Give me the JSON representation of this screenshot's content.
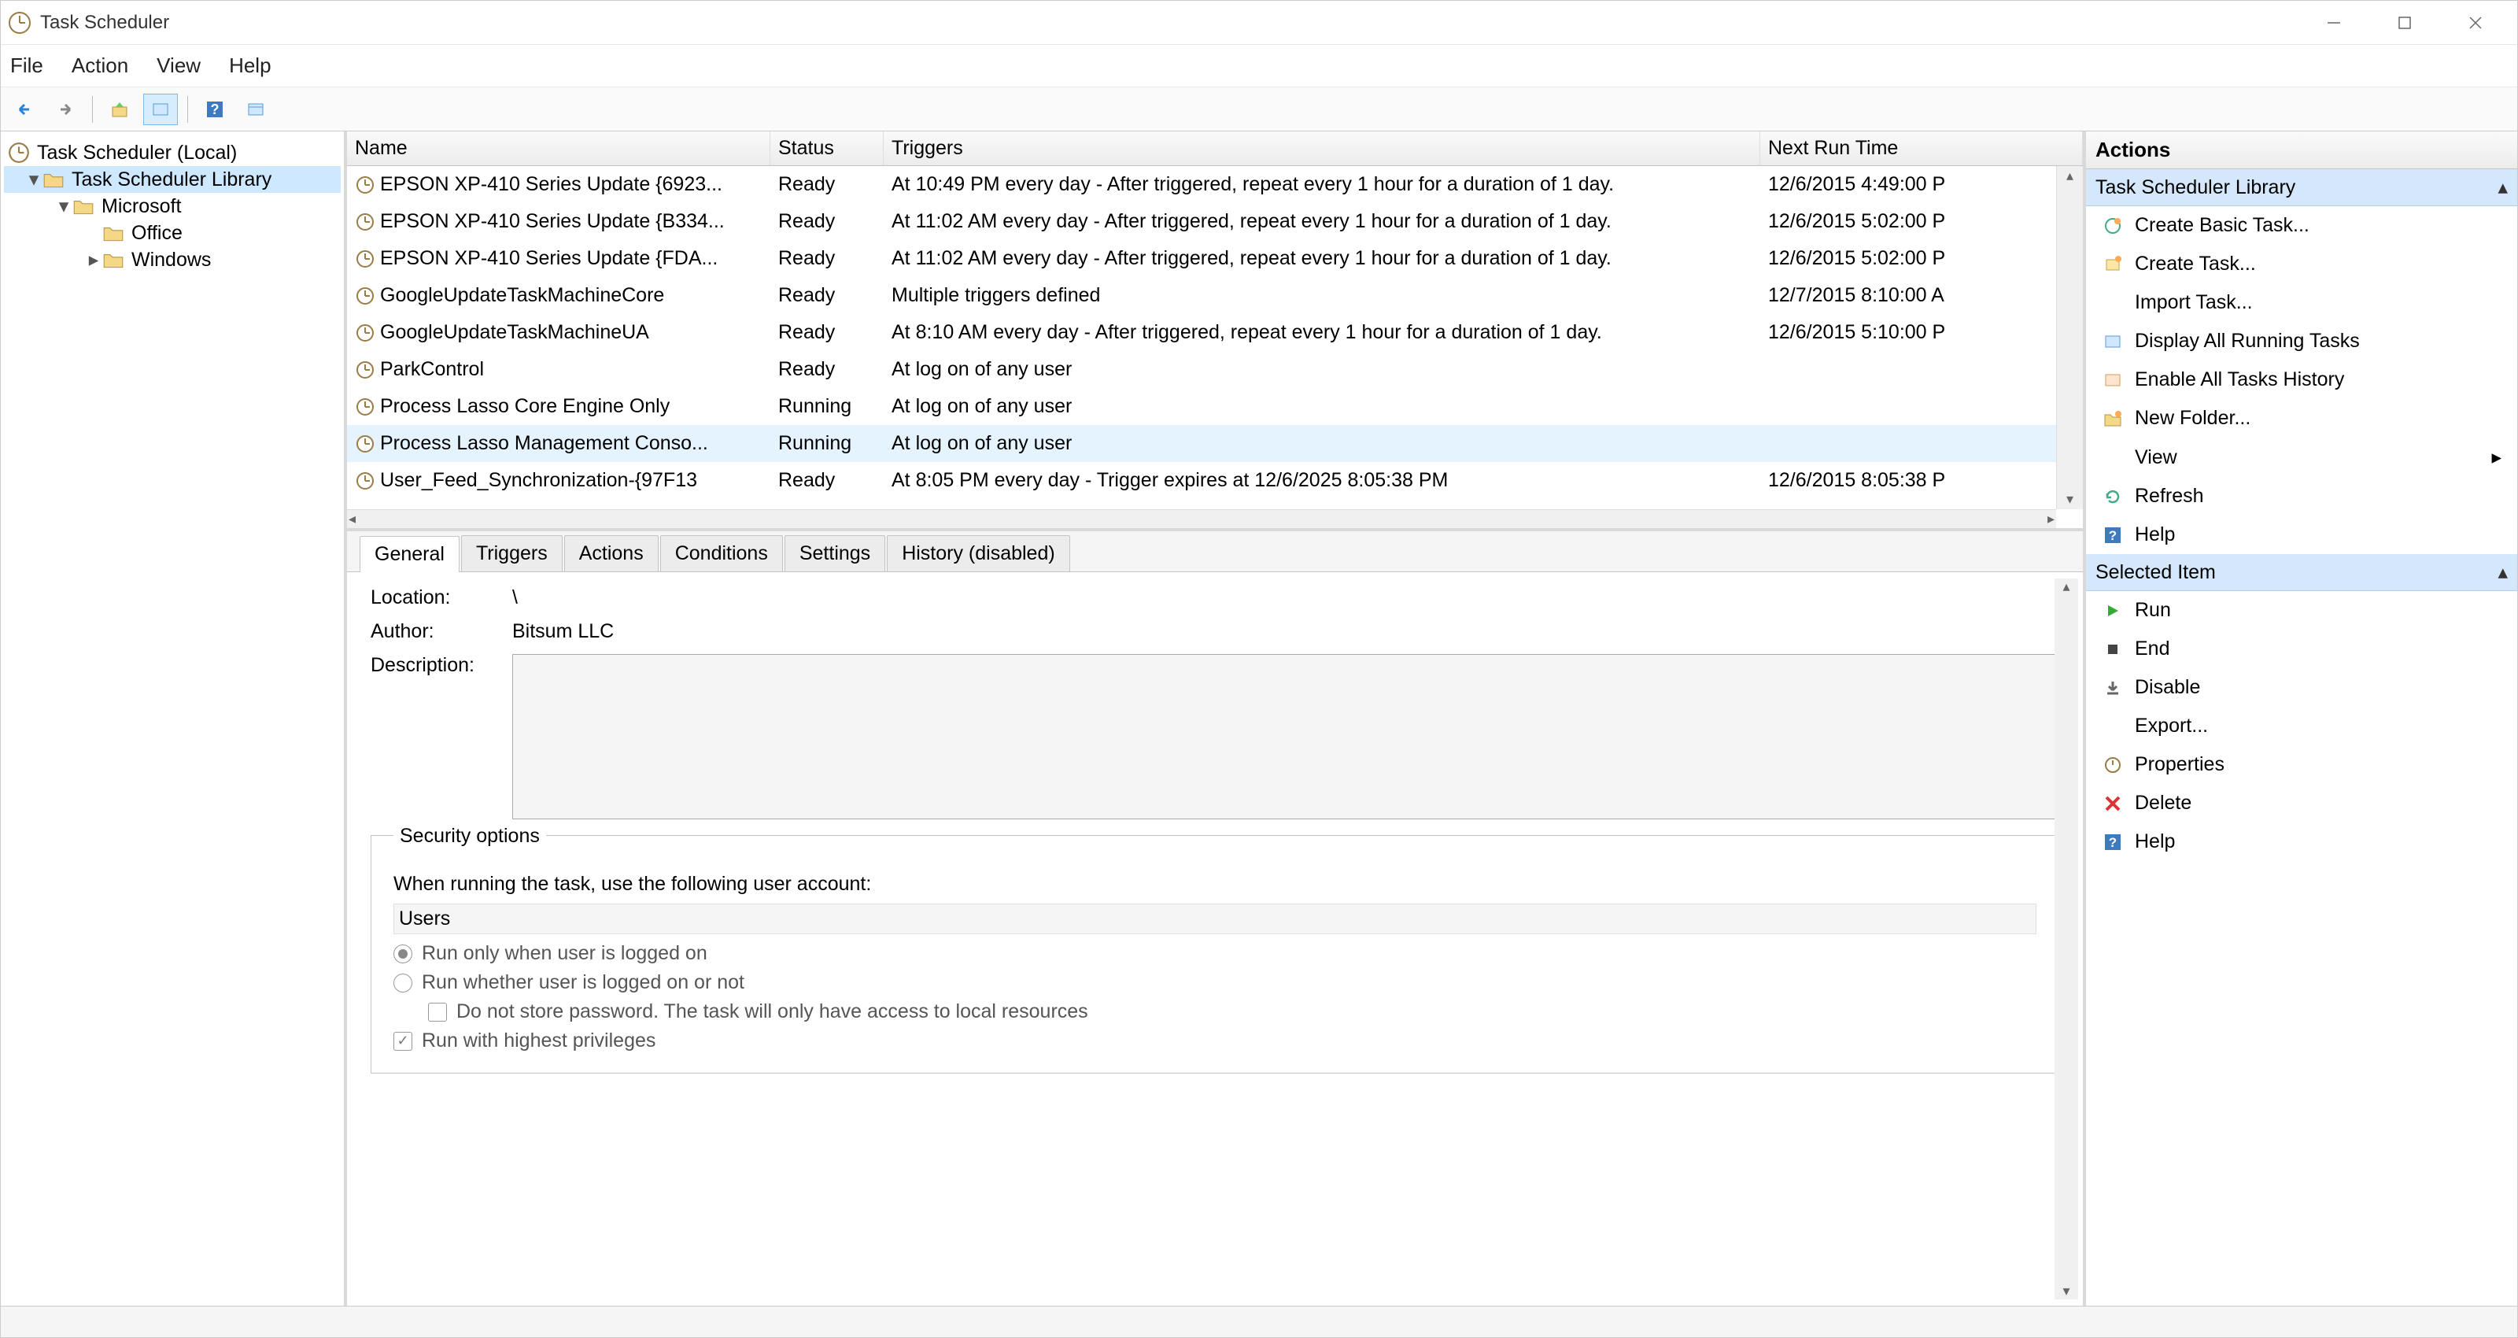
{
  "title": "Task Scheduler",
  "menu": [
    "File",
    "Action",
    "View",
    "Help"
  ],
  "tree": {
    "root": "Task Scheduler (Local)",
    "lib": "Task Scheduler Library",
    "ms": "Microsoft",
    "office": "Office",
    "windows": "Windows"
  },
  "columns": {
    "name": "Name",
    "status": "Status",
    "triggers": "Triggers",
    "next": "Next Run Time"
  },
  "tasks": [
    {
      "name": "EPSON XP-410 Series Update {6923...",
      "status": "Ready",
      "triggers": "At 10:49 PM every day - After triggered, repeat every 1 hour for a duration of 1 day.",
      "next": "12/6/2015 4:49:00 P"
    },
    {
      "name": "EPSON XP-410 Series Update {B334...",
      "status": "Ready",
      "triggers": "At 11:02 AM every day - After triggered, repeat every 1 hour for a duration of 1 day.",
      "next": "12/6/2015 5:02:00 P"
    },
    {
      "name": "EPSON XP-410 Series Update {FDA...",
      "status": "Ready",
      "triggers": "At 11:02 AM every day - After triggered, repeat every 1 hour for a duration of 1 day.",
      "next": "12/6/2015 5:02:00 P"
    },
    {
      "name": "GoogleUpdateTaskMachineCore",
      "status": "Ready",
      "triggers": "Multiple triggers defined",
      "next": "12/7/2015 8:10:00 A"
    },
    {
      "name": "GoogleUpdateTaskMachineUA",
      "status": "Ready",
      "triggers": "At 8:10 AM every day - After triggered, repeat every 1 hour for a duration of 1 day.",
      "next": "12/6/2015 5:10:00 P"
    },
    {
      "name": "ParkControl",
      "status": "Ready",
      "triggers": "At log on of any user",
      "next": ""
    },
    {
      "name": "Process Lasso Core Engine Only",
      "status": "Running",
      "triggers": "At log on of any user",
      "next": ""
    },
    {
      "name": "Process Lasso Management Conso...",
      "status": "Running",
      "triggers": "At log on of any user",
      "next": "",
      "selected": true
    },
    {
      "name": "User_Feed_Synchronization-{97F13",
      "status": "Ready",
      "triggers": "At 8:05 PM every day - Trigger expires at 12/6/2025 8:05:38 PM",
      "next": "12/6/2015 8:05:38 P"
    }
  ],
  "tabs": [
    "General",
    "Triggers",
    "Actions",
    "Conditions",
    "Settings",
    "History (disabled)"
  ],
  "general": {
    "location_l": "Location:",
    "location_v": "\\",
    "author_l": "Author:",
    "author_v": "Bitsum LLC",
    "desc_l": "Description:"
  },
  "security": {
    "legend": "Security options",
    "line1": "When running the task, use the following user account:",
    "account": "Users",
    "r1": "Run only when user is logged on",
    "r2": "Run whether user is logged on or not",
    "c1": "Do not store password.  The task will only have access to local resources",
    "c2": "Run with highest privileges"
  },
  "actions": {
    "title": "Actions",
    "section1": "Task Scheduler Library",
    "items1": [
      "Create Basic Task...",
      "Create Task...",
      "Import Task...",
      "Display All Running Tasks",
      "Enable All Tasks History",
      "New Folder...",
      "View",
      "Refresh",
      "Help"
    ],
    "section2": "Selected Item",
    "items2": [
      "Run",
      "End",
      "Disable",
      "Export...",
      "Properties",
      "Delete",
      "Help"
    ]
  }
}
